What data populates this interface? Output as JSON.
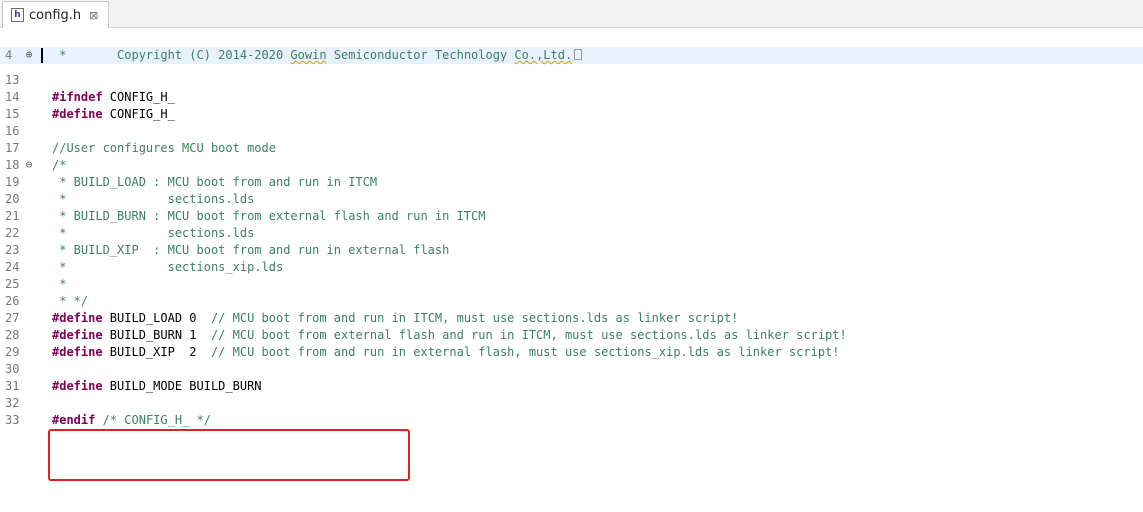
{
  "tab": {
    "filename": "config.h",
    "icon": "header-file-icon",
    "close": "⊠"
  },
  "lines": [
    {
      "num": "4",
      "fold": "⊕",
      "caret": true,
      "highlight": true,
      "segments": [
        {
          "t": "cmt",
          "v": " *       Copyright (C) 2014-2020 "
        },
        {
          "t": "cmt",
          "v": "Gowin",
          "sq": true
        },
        {
          "t": "cmt",
          "v": " Semiconductor Technology "
        },
        {
          "t": "cmt",
          "v": "Co.,Ltd.",
          "sq": true
        },
        {
          "t": "box",
          "v": ""
        }
      ]
    },
    {
      "num": "13",
      "segments": []
    },
    {
      "num": "14",
      "segments": [
        {
          "t": "dir",
          "v": "#ifndef"
        },
        {
          "t": "plain",
          "v": " CONFIG_H_"
        }
      ]
    },
    {
      "num": "15",
      "segments": [
        {
          "t": "dir",
          "v": "#define"
        },
        {
          "t": "plain",
          "v": " CONFIG_H_"
        }
      ]
    },
    {
      "num": "16",
      "segments": []
    },
    {
      "num": "17",
      "segments": [
        {
          "t": "cmt",
          "v": "//User configures MCU boot mode"
        }
      ]
    },
    {
      "num": "18",
      "fold": "⊖",
      "segments": [
        {
          "t": "cmt",
          "v": "/*"
        }
      ]
    },
    {
      "num": "19",
      "segments": [
        {
          "t": "cmt",
          "v": " * BUILD_LOAD : MCU boot from and run in ITCM"
        }
      ]
    },
    {
      "num": "20",
      "segments": [
        {
          "t": "cmt",
          "v": " *              sections.lds"
        }
      ]
    },
    {
      "num": "21",
      "segments": [
        {
          "t": "cmt",
          "v": " * BUILD_BURN : MCU boot from external flash and run in ITCM"
        }
      ]
    },
    {
      "num": "22",
      "segments": [
        {
          "t": "cmt",
          "v": " *              sections.lds"
        }
      ]
    },
    {
      "num": "23",
      "segments": [
        {
          "t": "cmt",
          "v": " * BUILD_XIP  : MCU boot from and run in external flash"
        }
      ]
    },
    {
      "num": "24",
      "segments": [
        {
          "t": "cmt",
          "v": " *              sections_xip.lds"
        }
      ]
    },
    {
      "num": "25",
      "segments": [
        {
          "t": "cmt",
          "v": " *"
        }
      ]
    },
    {
      "num": "26",
      "segments": [
        {
          "t": "cmt",
          "v": " * */"
        }
      ]
    },
    {
      "num": "27",
      "segments": [
        {
          "t": "dir",
          "v": "#define"
        },
        {
          "t": "plain",
          "v": " BUILD_LOAD 0  "
        },
        {
          "t": "cmt",
          "v": "// MCU boot from and run in ITCM, must use sections.lds as linker script!"
        }
      ]
    },
    {
      "num": "28",
      "segments": [
        {
          "t": "dir",
          "v": "#define"
        },
        {
          "t": "plain",
          "v": " BUILD_BURN 1  "
        },
        {
          "t": "cmt",
          "v": "// MCU boot from external flash and run in ITCM, must use sections.lds as linker script!"
        }
      ]
    },
    {
      "num": "29",
      "segments": [
        {
          "t": "dir",
          "v": "#define"
        },
        {
          "t": "plain",
          "v": " BUILD_XIP  2  "
        },
        {
          "t": "cmt",
          "v": "// MCU boot from and run in external flash, must use sections_xip.lds as linker script!"
        }
      ]
    },
    {
      "num": "30",
      "segments": []
    },
    {
      "num": "31",
      "segments": [
        {
          "t": "dir",
          "v": "#define"
        },
        {
          "t": "plain",
          "v": " BUILD_MODE BUILD_BURN"
        }
      ]
    },
    {
      "num": "32",
      "segments": []
    },
    {
      "num": "33",
      "segments": [
        {
          "t": "dir",
          "v": "#endif"
        },
        {
          "t": "plain",
          "v": " "
        },
        {
          "t": "cmt",
          "v": "/* CONFIG_H_ */"
        }
      ]
    }
  ],
  "colors": {
    "directive": "#7f0055",
    "comment": "#3f7f5f",
    "highlight_box": "#e02020",
    "current_line": "#e8f2fe"
  }
}
